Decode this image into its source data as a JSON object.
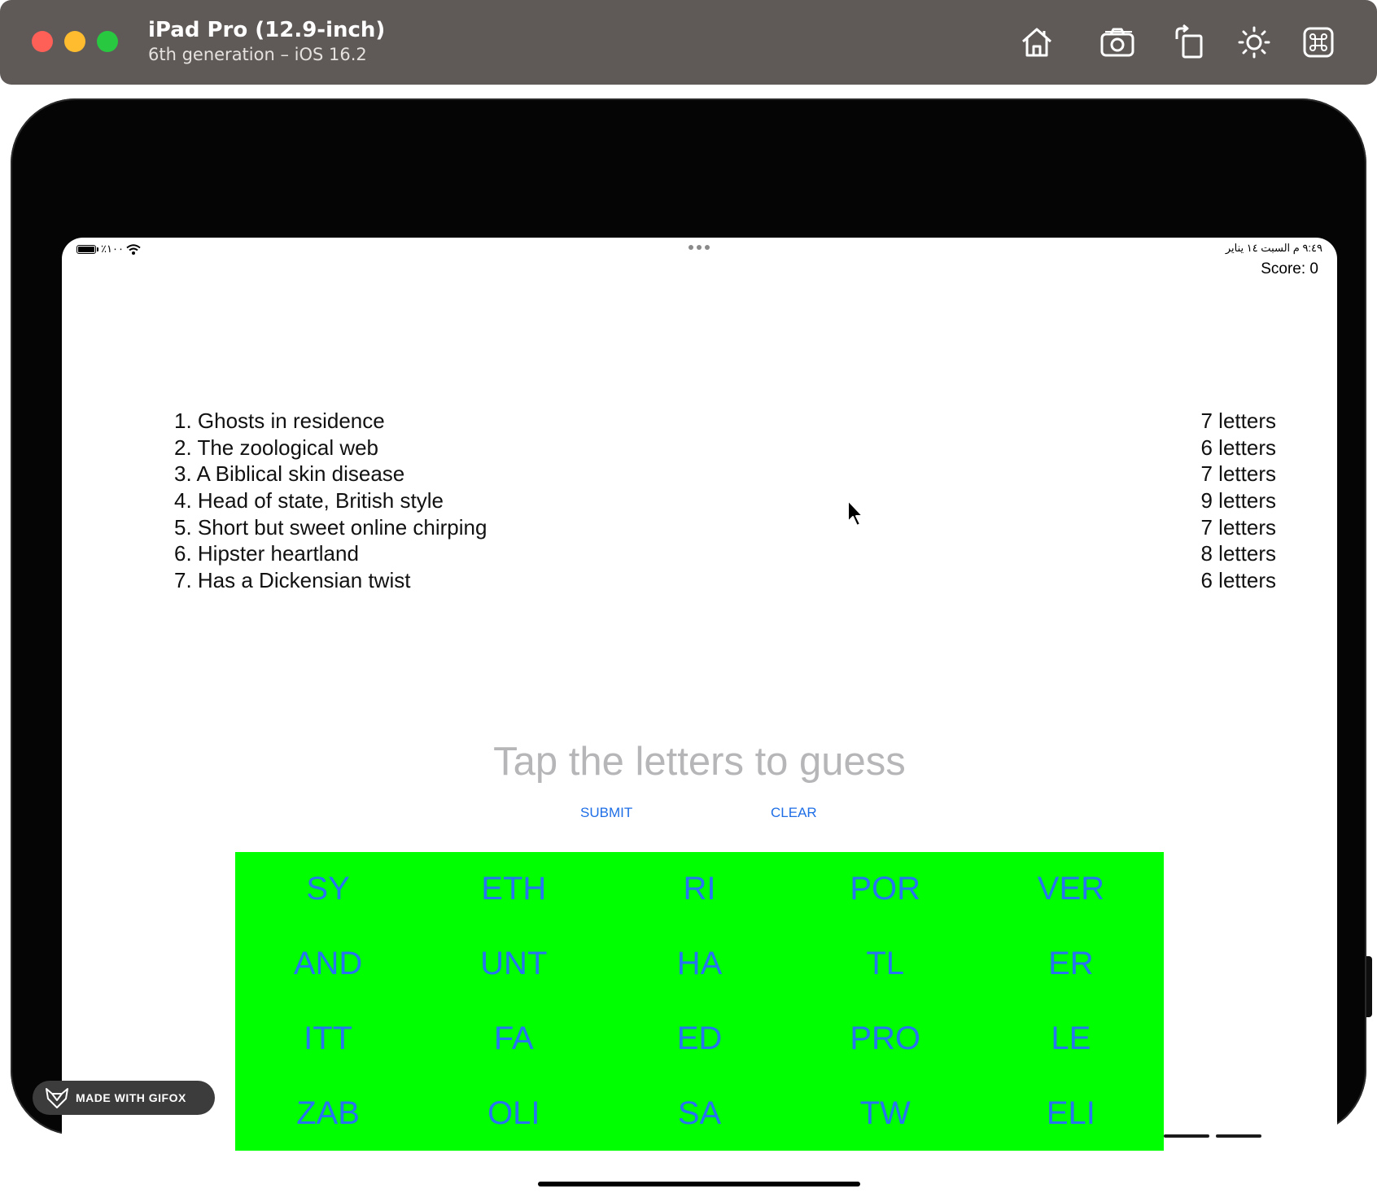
{
  "window": {
    "device_name": "iPad Pro (12.9-inch)",
    "device_subtitle": "6th generation – iOS 16.2",
    "toolbar_icons": [
      "home-icon",
      "screenshot-icon",
      "rotate-icon",
      "brightness-icon",
      "command-icon"
    ],
    "traffic_lights": {
      "close": "#fe5f57",
      "minimize": "#febc2e",
      "zoom": "#28c840"
    }
  },
  "status_bar": {
    "battery_percent": "٪١٠٠",
    "date_time": "٩:٤٩ م   السبت ١٤ يناير"
  },
  "game": {
    "score_label": "Score: 0",
    "clues": [
      {
        "clue": "1. Ghosts in residence",
        "length": "7 letters"
      },
      {
        "clue": "2. The zoological web",
        "length": "6 letters"
      },
      {
        "clue": "3. A Biblical skin disease",
        "length": "7 letters"
      },
      {
        "clue": "4. Head of state, British style",
        "length": "9 letters"
      },
      {
        "clue": "5. Short but sweet online chirping",
        "length": "7 letters"
      },
      {
        "clue": "6. Hipster heartland",
        "length": "8 letters"
      },
      {
        "clue": "7. Has a Dickensian twist",
        "length": "6 letters"
      }
    ],
    "prompt": "Tap the letters to guess",
    "submit_label": "SUBMIT",
    "clear_label": "CLEAR",
    "letter_groups": [
      "SY",
      "ETH",
      "RI",
      "POR",
      "VER",
      "AND",
      "UNT",
      "HA",
      "TL",
      "ER",
      "ITT",
      "FA",
      "ED",
      "PRO",
      "LE",
      "ZAB",
      "OLI",
      "SA",
      "TW",
      "ELI"
    ],
    "colors": {
      "grid_background": "#00ff00",
      "letter_text": "#2773f2",
      "button_text": "#1e6ee6",
      "prompt_text": "#b6b6b8"
    }
  },
  "watermark": {
    "text": "MADE WITH GIFOX"
  }
}
